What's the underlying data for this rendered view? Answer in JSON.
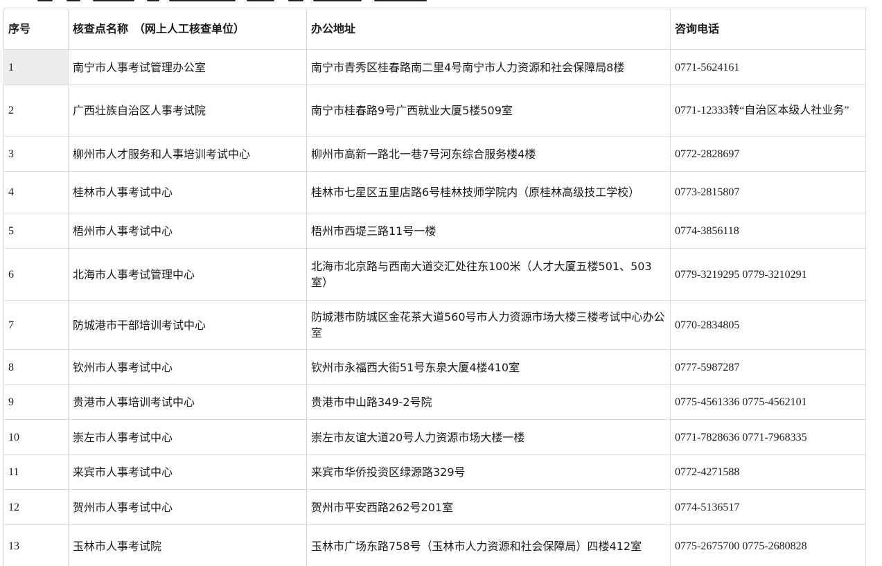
{
  "table": {
    "headers": [
      "序号",
      "核查点名称　（网上人工核查单位）",
      "办公地址",
      "咨询电话"
    ],
    "rows": [
      {
        "seq": "1",
        "name": "南宁市人事考试管理办公室",
        "address": "南宁市青秀区桂春路南二里4号南宁市人力资源和社会保障局8楼",
        "phone": "0771-5624161"
      },
      {
        "seq": "2",
        "name": "广西壮族自治区人事考试院",
        "address": "南宁市桂春路9号广西就业大厦5楼509室",
        "phone": "0771-12333转“自治区本级人社业务”"
      },
      {
        "seq": "3",
        "name": "柳州市人才服务和人事培训考试中心",
        "address": "柳州市高新一路北一巷7号河东综合服务楼4楼",
        "phone": "0772-2828697"
      },
      {
        "seq": "4",
        "name": "桂林市人事考试中心",
        "address": "桂林市七星区五里店路6号桂林技师学院内（原桂林高级技工学校）",
        "phone": "0773-2815807"
      },
      {
        "seq": "5",
        "name": "梧州市人事考试中心",
        "address": "梧州市西堤三路11号一楼",
        "phone": "0774-3856118"
      },
      {
        "seq": "6",
        "name": "北海市人事考试管理中心",
        "address": "北海市北京路与西南大道交汇处往东100米（人才大厦五楼501、503室）",
        "phone": "0779-3219295  0779-3210291"
      },
      {
        "seq": "7",
        "name": "防城港市干部培训考试中心",
        "address": "防城港市防城区金花茶大道560号市人力资源市场大楼三楼考试中心办公室",
        "phone": "0770-2834805"
      },
      {
        "seq": "8",
        "name": "钦州市人事考试中心",
        "address": "钦州市永福西大街51号东泉大厦4楼410室",
        "phone": "0777-5987287"
      },
      {
        "seq": "9",
        "name": "贵港市人事培训考试中心",
        "address": "贵港市中山路349-2号院",
        "phone": "0775-4561336  0775-4562101"
      },
      {
        "seq": "10",
        "name": "崇左市人事考试中心",
        "address": "崇左市友谊大道20号人力资源市场大楼一楼",
        "phone": "0771-7828636  0771-7968335"
      },
      {
        "seq": "11",
        "name": "来宾市人事考试中心",
        "address": "来宾市华侨投资区绿源路329号",
        "phone": "0772-4271588"
      },
      {
        "seq": "12",
        "name": "贺州市人事考试中心",
        "address": "贺州市平安西路262号201室",
        "phone": "0774-5136517"
      },
      {
        "seq": "13",
        "name": "玉林市人事考试院",
        "address": "玉林市广场东路758号（玉林市人力资源和社会保障局）四楼412室",
        "phone": "0775-2675700  0775-2680828"
      }
    ]
  }
}
